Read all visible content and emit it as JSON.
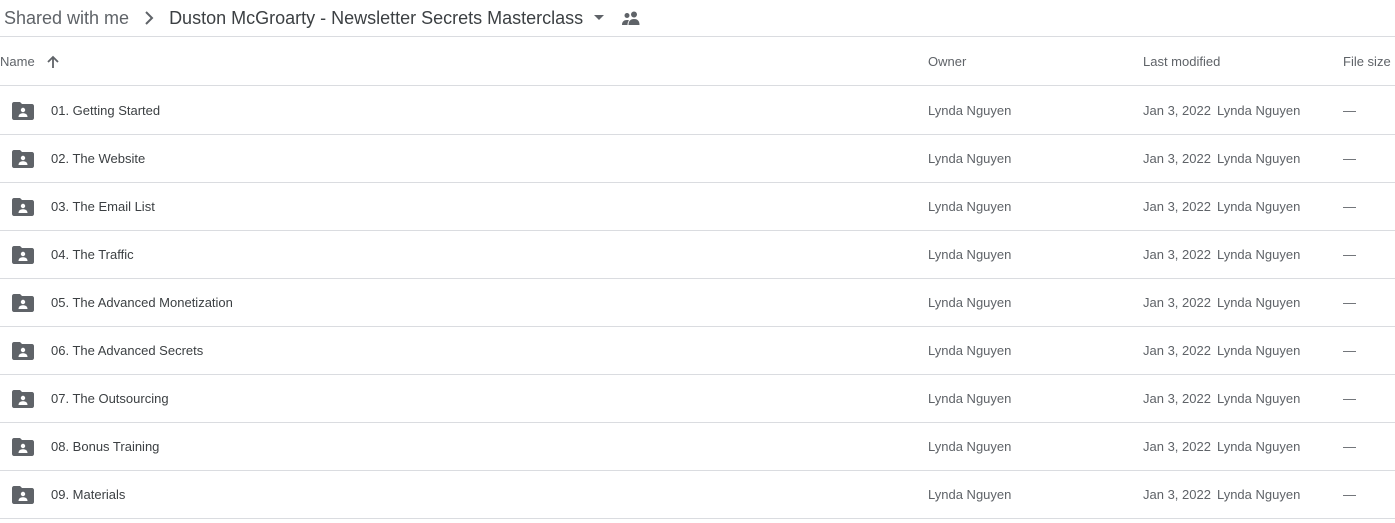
{
  "breadcrumb": {
    "root_label": "Shared with me",
    "current_folder": "Duston McGroarty - Newsletter Secrets Masterclass"
  },
  "columns": {
    "name": "Name",
    "owner": "Owner",
    "last_modified": "Last modified",
    "file_size": "File size"
  },
  "sort": {
    "column": "Name",
    "direction": "ascending"
  },
  "icons": {
    "separator": "chevron-right-icon",
    "dropdown": "arrow-drop-down-icon",
    "shared": "people-icon",
    "sort": "arrow-up-icon",
    "row": "shared-folder-icon"
  },
  "colors": {
    "folder_icon": "#5f6368",
    "divider": "#dadce0"
  },
  "rows": [
    {
      "name": "01. Getting Started",
      "owner": "Lynda Nguyen",
      "modified_date": "Jan 3, 2022",
      "modified_by": "Lynda Nguyen",
      "size": "—"
    },
    {
      "name": "02. The Website",
      "owner": "Lynda Nguyen",
      "modified_date": "Jan 3, 2022",
      "modified_by": "Lynda Nguyen",
      "size": "—"
    },
    {
      "name": "03. The Email List",
      "owner": "Lynda Nguyen",
      "modified_date": "Jan 3, 2022",
      "modified_by": "Lynda Nguyen",
      "size": "—"
    },
    {
      "name": "04. The Traffic",
      "owner": "Lynda Nguyen",
      "modified_date": "Jan 3, 2022",
      "modified_by": "Lynda Nguyen",
      "size": "—"
    },
    {
      "name": "05. The Advanced Monetization",
      "owner": "Lynda Nguyen",
      "modified_date": "Jan 3, 2022",
      "modified_by": "Lynda Nguyen",
      "size": "—"
    },
    {
      "name": "06. The Advanced Secrets",
      "owner": "Lynda Nguyen",
      "modified_date": "Jan 3, 2022",
      "modified_by": "Lynda Nguyen",
      "size": "—"
    },
    {
      "name": "07. The Outsourcing",
      "owner": "Lynda Nguyen",
      "modified_date": "Jan 3, 2022",
      "modified_by": "Lynda Nguyen",
      "size": "—"
    },
    {
      "name": "08. Bonus Training",
      "owner": "Lynda Nguyen",
      "modified_date": "Jan 3, 2022",
      "modified_by": "Lynda Nguyen",
      "size": "—"
    },
    {
      "name": "09. Materials",
      "owner": "Lynda Nguyen",
      "modified_date": "Jan 3, 2022",
      "modified_by": "Lynda Nguyen",
      "size": "—"
    }
  ]
}
